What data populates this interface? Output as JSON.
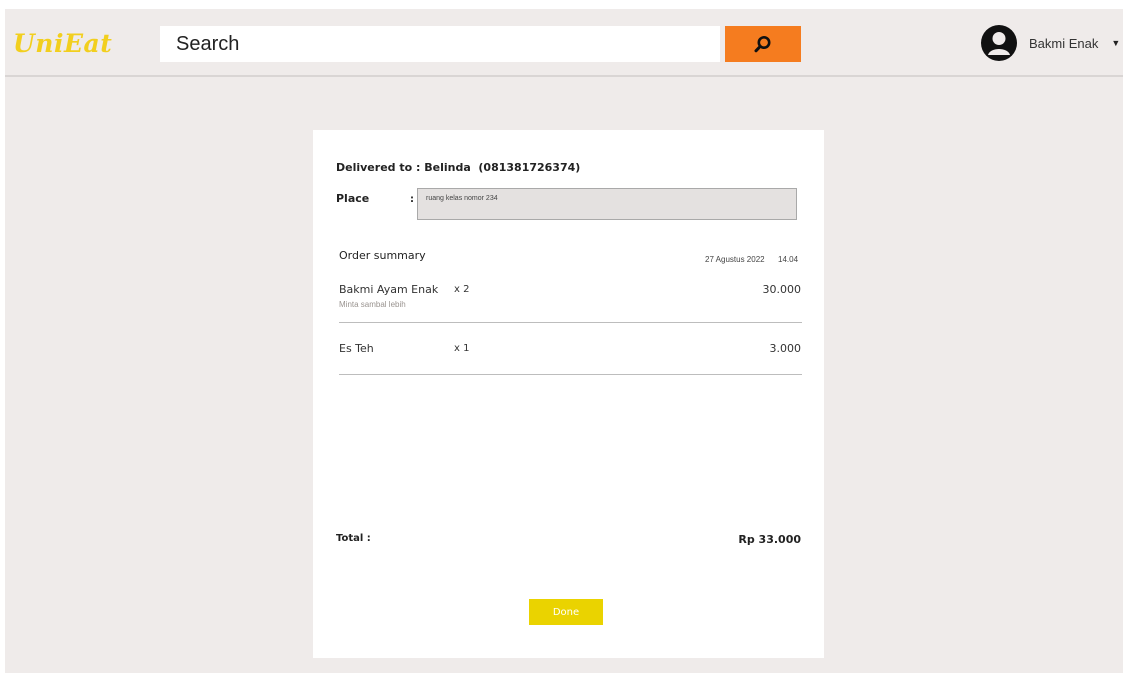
{
  "header": {
    "logo": "UniEat",
    "search_placeholder": "Search",
    "search_value": "",
    "search_icon": "search-icon",
    "user_name": "Bakmi Enak",
    "dropdown_caret": "▼"
  },
  "receipt": {
    "delivered_text": "Delivered to : Belinda  (081381726374)",
    "place_label": "Place",
    "place_colon": ":",
    "place_value": "ruang kelas nomor 234",
    "summary_title": "Order summary",
    "date": "27 Agustus 2022",
    "time": "14.04",
    "items": [
      {
        "name": "Bakmi Ayam Enak",
        "qty": "x 2",
        "price": "30.000",
        "note": "Minta sambal lebih"
      },
      {
        "name": "Es Teh",
        "qty": "x 1",
        "price": "3.000",
        "note": ""
      }
    ],
    "total_label": "Total :",
    "total_value": "Rp 33.000",
    "done_label": "Done"
  },
  "colors": {
    "logo": "#f2cf1e",
    "search_button": "#f57c1f",
    "done_button": "#ead300",
    "background": "#efebea",
    "place_field": "#e4e1e0"
  }
}
